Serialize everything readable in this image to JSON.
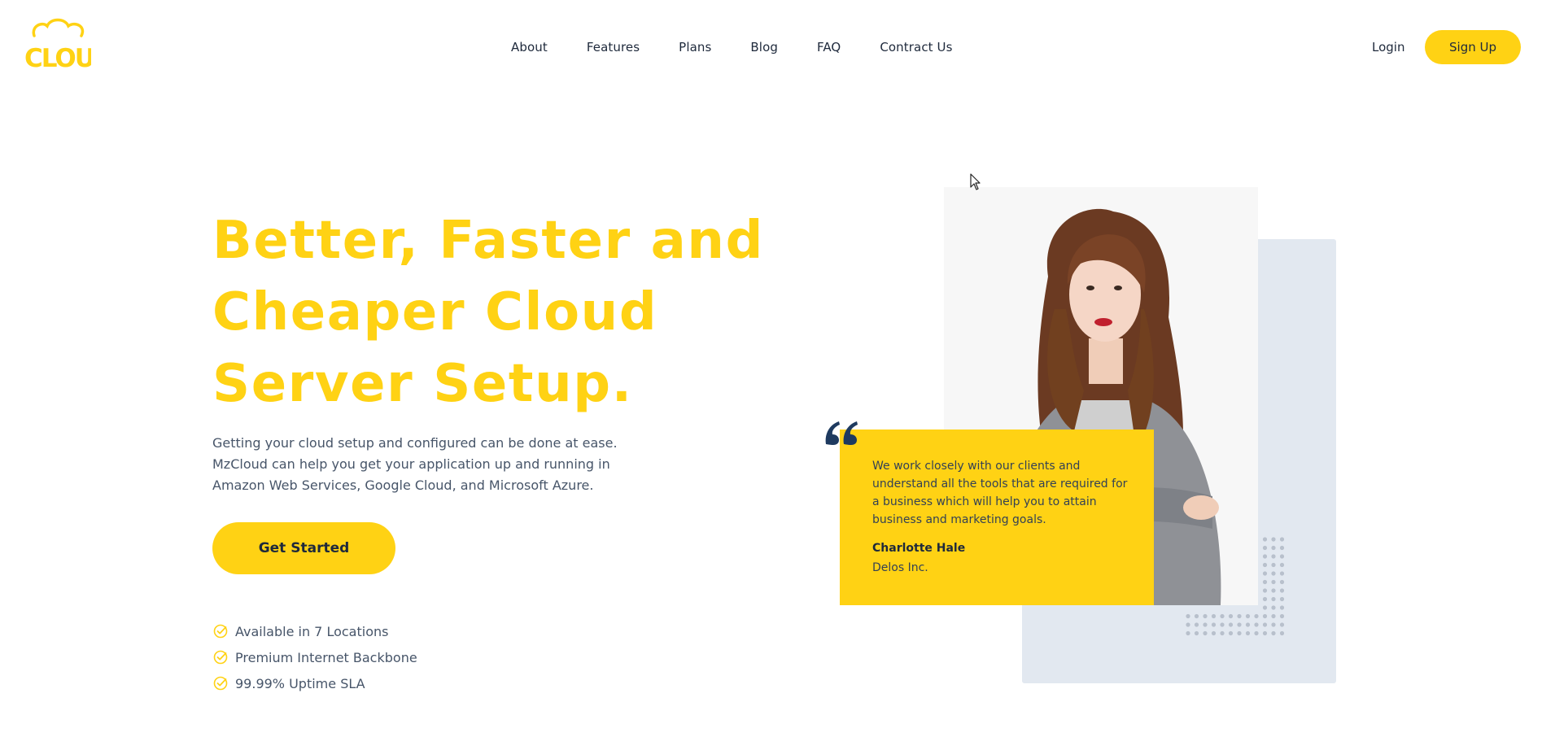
{
  "header": {
    "logo_text": "CLOUD",
    "nav": [
      {
        "label": "About"
      },
      {
        "label": "Features"
      },
      {
        "label": "Plans"
      },
      {
        "label": "Blog"
      },
      {
        "label": "FAQ"
      },
      {
        "label": "Contract Us"
      }
    ],
    "login_label": "Login",
    "signup_label": "Sign Up"
  },
  "hero": {
    "title_lines": [
      "Better, Faster and",
      "Cheaper Cloud",
      "Server Setup."
    ],
    "description_lines": [
      "Getting your cloud setup and configured can be done at ease.",
      "MzCloud can help you get your application up and running in",
      "Amazon Web Services, Google Cloud, and Microsoft Azure."
    ],
    "cta_label": "Get Started",
    "features": [
      {
        "icon": "check-circle-icon",
        "label": "Available in 7 Locations"
      },
      {
        "icon": "check-circle-icon",
        "label": "Premium Internet Backbone"
      },
      {
        "icon": "check-circle-icon",
        "label": "99.99% Uptime SLA"
      }
    ]
  },
  "testimonial": {
    "quote_lines": [
      "We work closely with our clients and",
      "understand all the tools that are required for",
      "a business which will help you to attain",
      "business and marketing goals."
    ],
    "name": "Charlotte Hale",
    "company": "Delos Inc.",
    "photo_icon": "person-photo"
  },
  "colors": {
    "accent": "#ffd214",
    "text_dark": "#1e293b",
    "text_body": "#475569",
    "panel_bg": "#e2e8f0",
    "quote_mark": "#1e3a5f"
  }
}
